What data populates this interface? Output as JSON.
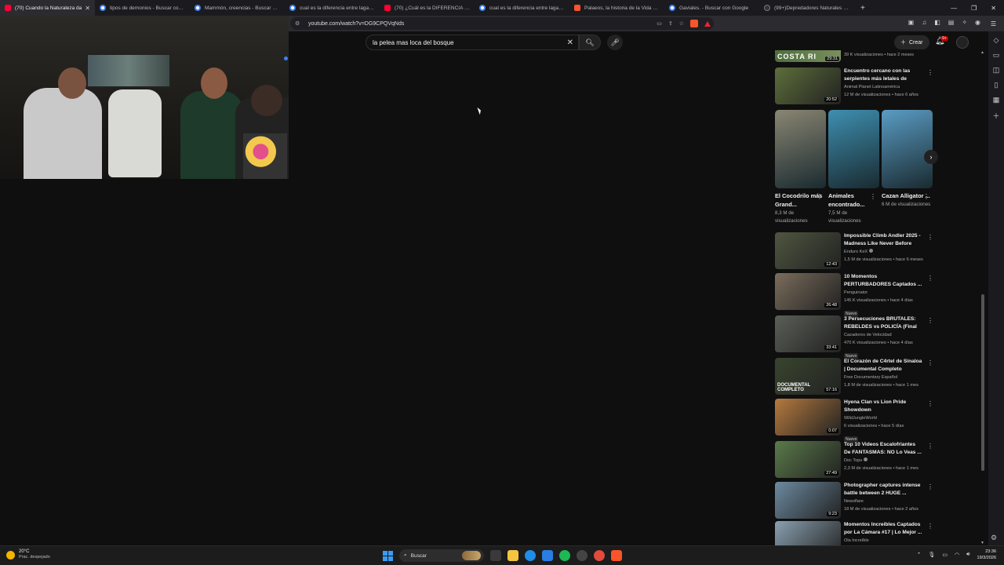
{
  "browser": {
    "tabs": [
      {
        "title": "(70) Cuando la Naturaleza da",
        "icon": "youtube-icon",
        "active": true
      },
      {
        "title": "tipos de demonios - Buscar con Goo",
        "icon": "google-icon"
      },
      {
        "title": "Mammón, creencias - Buscar con Go",
        "icon": "google-icon"
      },
      {
        "title": "cual es la diferencia entre lagarto co",
        "icon": "google-icon"
      },
      {
        "title": "(70) ¿Cuál es la DIFERENCIA entre CO",
        "icon": "youtube-icon"
      },
      {
        "title": "cual es la diferencia entre lagarto co",
        "icon": "google-icon"
      },
      {
        "title": "Palaeos, la historia de la Vida en la T",
        "icon": "brave-icon"
      },
      {
        "title": "Gaviales. - Buscar con Google",
        "icon": "google-icon"
      },
      {
        "title": "(99+)Depredadores Naturales de los",
        "icon": "site-icon"
      }
    ],
    "url": "youtube.com/watch?v=DG9CPQVqNds"
  },
  "youtube": {
    "search_value": "la pelea mas loca del bosque",
    "create_label": "Crear",
    "notif_badge": "9+"
  },
  "sidebar": {
    "top_partial": {
      "duration": "29:31",
      "thumb_text": "COSTA RI",
      "meta": "39 K visualizaciones • hace 2 meses"
    },
    "videos_top": [
      {
        "title": "Encuentro cercano con las serpientes más letales de Asia...",
        "channel": "Animal Planet Latinoamérica",
        "meta": "12 M de visualizaciones • hace 6 años",
        "duration": "20:52",
        "thumb": "#5d6e3a"
      }
    ],
    "shorts": [
      {
        "title": "El Cocodrilo más Grand...",
        "views": "8,3 M de visualizaciones",
        "color": "#8a8672"
      },
      {
        "title": "Animales encontrado...",
        "views": "7,5 M de visualizaciones",
        "color": "#3e8fb0"
      },
      {
        "title": "Cazan Alligator ...",
        "views": "6 M de visualizaciones",
        "color": "#5a9cc4"
      }
    ],
    "videos": [
      {
        "title": "Impossible Climb Andler 2025 - Madness Like Never Before",
        "channel": "Enduro KeX",
        "verified": true,
        "meta": "1,5 M de visualizaciones • hace 6 meses",
        "duration": "12:43",
        "new": "",
        "thumb": "#4f5640"
      },
      {
        "title": "10 Momentos PERTURBADORES Captados ...",
        "channel": "Penguinator",
        "verified": false,
        "meta": "145 K visualizaciones • hace 4 días",
        "duration": "26:48",
        "new": "Nuevo",
        "thumb": "#7a6d5c"
      },
      {
        "title": "3 Persecuciones BRUTALES: REBELDES vs POLICÍA (Final ...",
        "channel": "Cazadores de Velocidad",
        "verified": false,
        "meta": "470 K visualizaciones • hace 4 días",
        "duration": "33:41",
        "new": "Nuevo",
        "thumb": "#5b5f57"
      },
      {
        "title": "El Corazón de C4rtel de Sinaloa | Documental Completo",
        "channel": "Free Documentary Español",
        "verified": false,
        "meta": "1,8 M de visualizaciones • hace 1 mes",
        "duration": "57:16",
        "new": "",
        "thumb": "#39452e",
        "overlay": "DOCUMENTAL COMPLETO"
      },
      {
        "title": "Hyena Clan vs Lion Pride Showdown #Tags#WildAnimal...",
        "channel": "WildJungleWorld",
        "verified": false,
        "meta": "6 visualizaciones • hace 5 días",
        "duration": "0:07",
        "new": "Nuevo",
        "thumb": "#b57a3e"
      },
      {
        "title": "Top 10 Videos Escalofriantes De FANTASMAS: NO Lo Veas ...",
        "channel": "Doc Tops",
        "verified": true,
        "meta": "2,3 M de visualizaciones • hace 1 mes",
        "duration": "27:49",
        "new": "",
        "thumb": "#5a7a4a"
      },
      {
        "title": "Photographer captures intense battle between 2 HUGE ...",
        "channel": "Newsflare",
        "verified": false,
        "meta": "18 M de visualizaciones • hace 2 años",
        "duration": "9:23",
        "new": "",
        "thumb": "#6c8aa0"
      },
      {
        "title": "Momentos Increíbles Captados por La Cámara #17 | Lo Mejor ...",
        "channel": "Ola Increíble",
        "verified": false,
        "meta": "",
        "duration": "",
        "new": "",
        "thumb": "#8aa0b0"
      }
    ]
  },
  "taskbar": {
    "weather_temp": "20°C",
    "weather_desc": "Prac. despejado",
    "search_label": "Buscar",
    "time": "23:36",
    "date": "19/3/2026"
  }
}
